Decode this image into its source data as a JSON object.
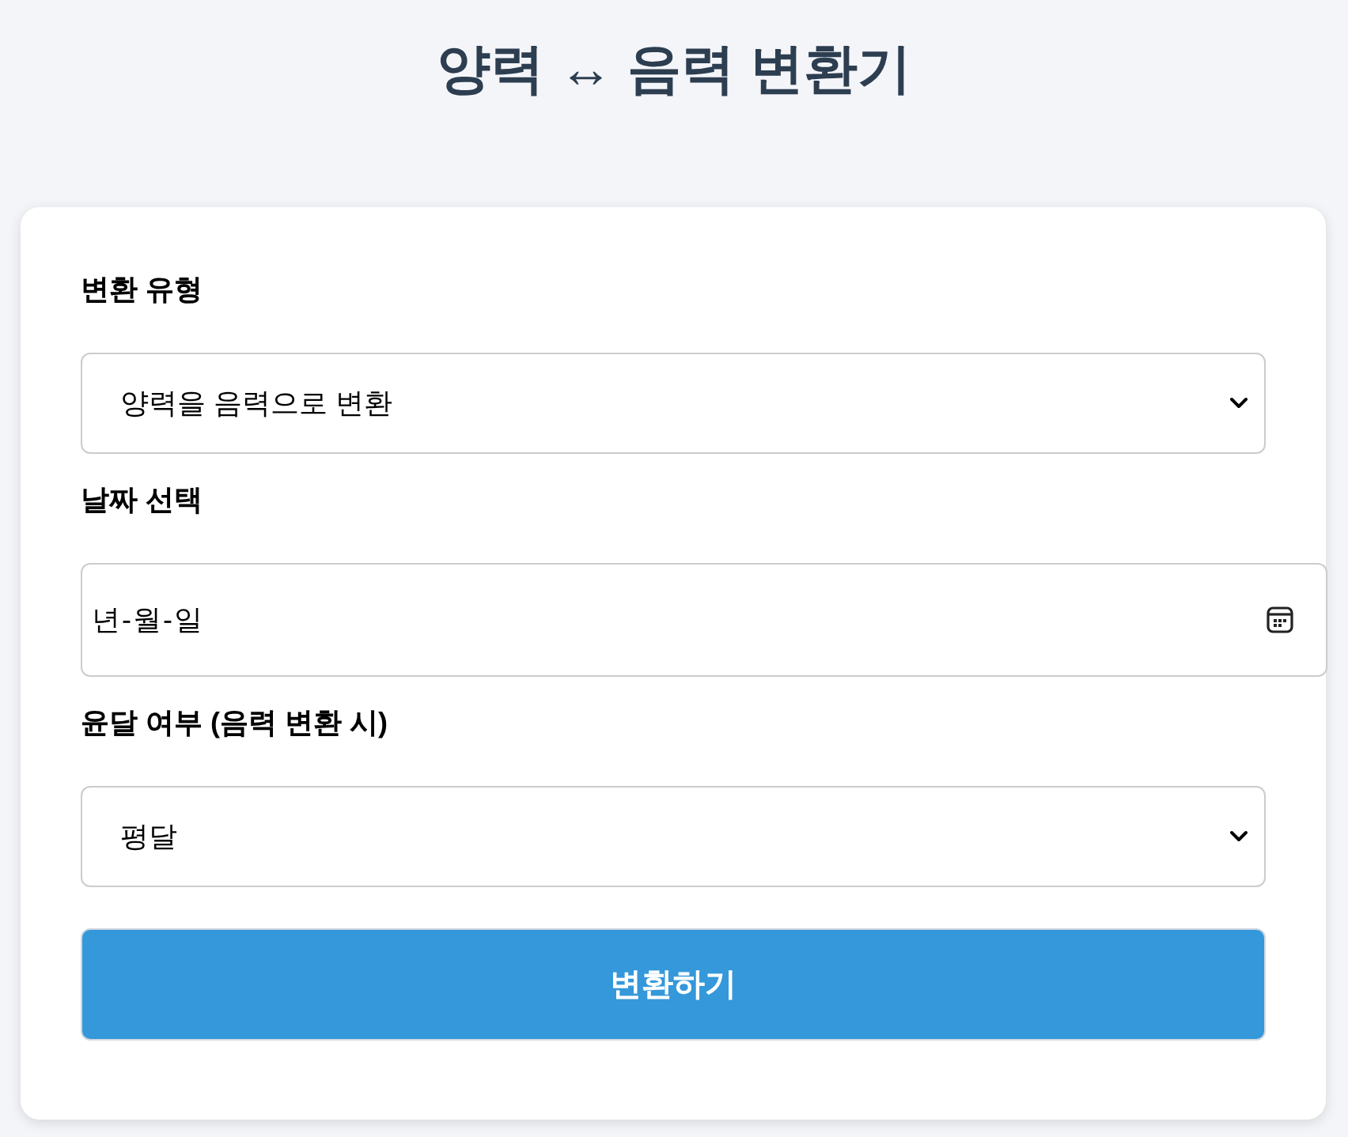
{
  "title": "양력 ↔ 음력 변환기",
  "form": {
    "fields": [
      {
        "kind": "select",
        "label": "변환 유형",
        "value": "양력을 음력으로 변환"
      },
      {
        "kind": "date",
        "label": "날짜 선택",
        "placeholder": "년-월-일"
      },
      {
        "kind": "select",
        "label": "윤달 여부 (음력 변환 시)",
        "value": "평달"
      }
    ],
    "submit": {
      "label": "변환하기"
    }
  }
}
